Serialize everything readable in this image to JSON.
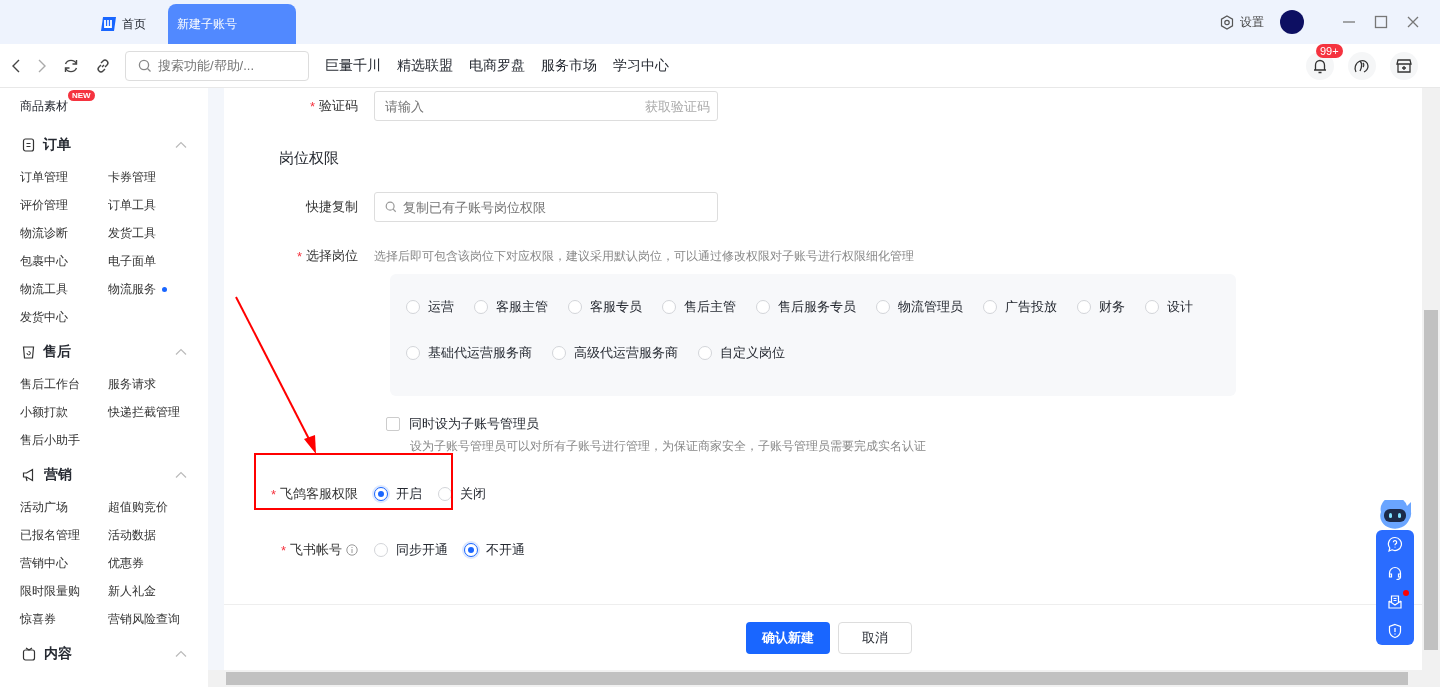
{
  "tabs": [
    {
      "label": "首页",
      "selected": false,
      "kind": "home"
    },
    {
      "label": "新建子账号",
      "selected": true,
      "kind": "page"
    }
  ],
  "title_bar": {
    "settings": "设置"
  },
  "toolbar": {
    "search_placeholder": "搜索功能/帮助/...",
    "links": [
      "巨量千川",
      "精选联盟",
      "电商罗盘",
      "服务市场",
      "学习中心"
    ],
    "notification_badge": "99+"
  },
  "sidebar": {
    "top_item": {
      "label": "商品素材",
      "badge": "NEW"
    },
    "sections": [
      {
        "title": "订单",
        "kind": "order",
        "expanded": true,
        "items": [
          {
            "label": "订单管理",
            "dot": false
          },
          {
            "label": "卡券管理",
            "dot": false
          },
          {
            "label": "评价管理",
            "dot": false
          },
          {
            "label": "订单工具",
            "dot": false
          },
          {
            "label": "物流诊断",
            "dot": false
          },
          {
            "label": "发货工具",
            "dot": false
          },
          {
            "label": "包裹中心",
            "dot": false
          },
          {
            "label": "电子面单",
            "dot": false
          },
          {
            "label": "物流工具",
            "dot": false
          },
          {
            "label": "物流服务",
            "dot": true
          },
          {
            "label": "发货中心",
            "dot": false
          }
        ]
      },
      {
        "title": "售后",
        "kind": "aftersale",
        "expanded": true,
        "items": [
          {
            "label": "售后工作台",
            "dot": false
          },
          {
            "label": "服务请求",
            "dot": false
          },
          {
            "label": "小额打款",
            "dot": false
          },
          {
            "label": "快递拦截管理",
            "dot": false
          },
          {
            "label": "售后小助手",
            "dot": false
          }
        ]
      },
      {
        "title": "营销",
        "kind": "marketing",
        "expanded": true,
        "items": [
          {
            "label": "活动广场",
            "dot": false
          },
          {
            "label": "超值购竞价",
            "dot": false
          },
          {
            "label": "已报名管理",
            "dot": false
          },
          {
            "label": "活动数据",
            "dot": false
          },
          {
            "label": "营销中心",
            "dot": false
          },
          {
            "label": "优惠券",
            "dot": false
          },
          {
            "label": "限时限量购",
            "dot": false
          },
          {
            "label": "新人礼金",
            "dot": false
          },
          {
            "label": "惊喜券",
            "dot": false
          },
          {
            "label": "营销风险查询",
            "dot": false
          }
        ]
      },
      {
        "title": "内容",
        "kind": "content",
        "expanded": true
      }
    ]
  },
  "form": {
    "required_mark": "*",
    "verification": {
      "label": "验证码",
      "required": true,
      "placeholder": "请输入",
      "action": "获取验证码"
    },
    "section_title": "岗位权限",
    "quick_copy": {
      "label": "快捷复制",
      "placeholder": "复制已有子账号岗位权限"
    },
    "position": {
      "label": "选择岗位",
      "required": true,
      "hint": "选择后即可包含该岗位下对应权限，建议采用默认岗位，可以通过修改权限对子账号进行权限细化管理",
      "options": [
        {
          "label": "运营",
          "selected": false
        },
        {
          "label": "客服主管",
          "selected": false
        },
        {
          "label": "客服专员",
          "selected": false
        },
        {
          "label": "售后主管",
          "selected": false
        },
        {
          "label": "售后服务专员",
          "selected": false
        },
        {
          "label": "物流管理员",
          "selected": false
        },
        {
          "label": "广告投放",
          "selected": false
        },
        {
          "label": "财务",
          "selected": false
        },
        {
          "label": "设计",
          "selected": false
        },
        {
          "label": "基础代运营服务商",
          "selected": false
        },
        {
          "label": "高级代运营服务商",
          "selected": false
        },
        {
          "label": "自定义岗位",
          "selected": false
        }
      ]
    },
    "admin": {
      "label": "同时设为子账号管理员",
      "checked": false,
      "hint": "设为子账号管理员可以对所有子账号进行管理，为保证商家安全，子账号管理员需要完成实名认证"
    },
    "feige": {
      "label": "飞鸽客服权限",
      "required": true,
      "options": [
        {
          "label": "开启",
          "selected": true
        },
        {
          "label": "关闭",
          "selected": false
        }
      ]
    },
    "feishu": {
      "label": "飞书帐号",
      "required": true,
      "info": true,
      "options": [
        {
          "label": "同步开通",
          "selected": false
        },
        {
          "label": "不开通",
          "selected": true
        }
      ]
    }
  },
  "footer": {
    "buttons": [
      {
        "label": "确认新建",
        "kind": "primary"
      },
      {
        "label": "取消",
        "kind": "default"
      }
    ]
  }
}
